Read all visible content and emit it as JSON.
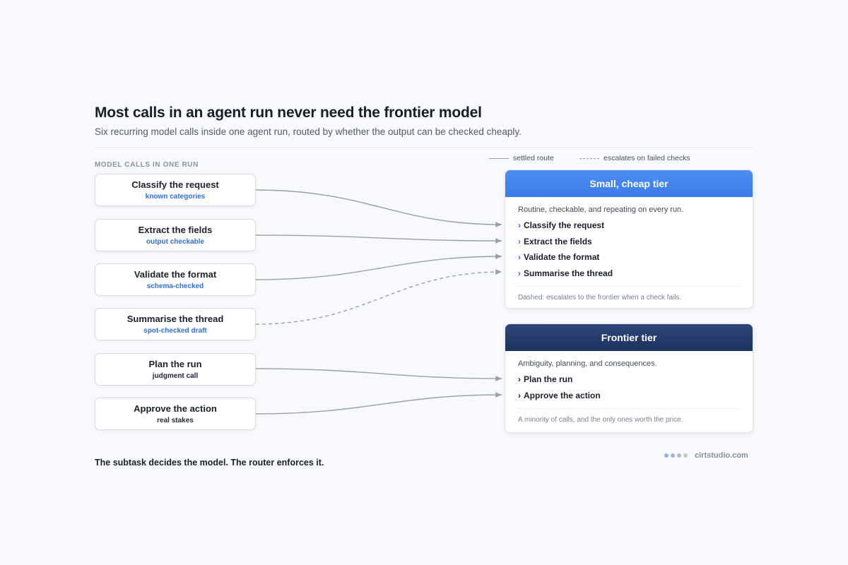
{
  "title": "Most calls in an agent run never need the frontier model",
  "subtitle": "Six recurring model calls inside one agent run, routed by whether the output can be checked cheaply.",
  "section_label": "MODEL CALLS IN ONE RUN",
  "legend": {
    "settled": "settled route",
    "escalates": "escalates on failed checks"
  },
  "calls": [
    {
      "name": "Classify the request",
      "tag": "known categories",
      "tag_color": "#2f6fe0",
      "route": "small",
      "style": "solid"
    },
    {
      "name": "Extract the fields",
      "tag": "output checkable",
      "tag_color": "#2f6fe0",
      "route": "small",
      "style": "solid"
    },
    {
      "name": "Validate the format",
      "tag": "schema-checked",
      "tag_color": "#2f6fe0",
      "route": "small",
      "style": "solid"
    },
    {
      "name": "Summarise the thread",
      "tag": "spot-checked draft",
      "tag_color": "#2f6fe0",
      "route": "small",
      "style": "dashed"
    },
    {
      "name": "Plan the run",
      "tag": "judgment call",
      "tag_color": "#232736",
      "route": "frontier",
      "style": "solid"
    },
    {
      "name": "Approve the action",
      "tag": "real stakes",
      "tag_color": "#232736",
      "route": "frontier",
      "style": "solid"
    }
  ],
  "small_tier": {
    "title": "Small, cheap tier",
    "description": "Routine, checkable, and repeating on every run.",
    "members": [
      "Classify the request",
      "Extract the fields",
      "Validate the format",
      "Summarise the thread"
    ],
    "note": "Dashed: escalates to the frontier when a check fails.",
    "color": "#3b7bea"
  },
  "frontier_tier": {
    "title": "Frontier tier",
    "description": "Ambiguity, planning, and consequences.",
    "members": [
      "Plan the run",
      "Approve the action"
    ],
    "note": "A minority of calls, and the only ones worth the price.",
    "color": "#1d3160"
  },
  "footer": "The subtask decides the model. The router enforces it.",
  "brand": {
    "name": "cirtstudio.com",
    "dot_colors": [
      "#8fb0e8",
      "#a7b4cc",
      "#b5bac4",
      "#c4c8cf"
    ]
  },
  "colors": {
    "link": "#9aa0ab",
    "accent": "#2f6fe0"
  },
  "member_icon": "chevron-right-icon"
}
